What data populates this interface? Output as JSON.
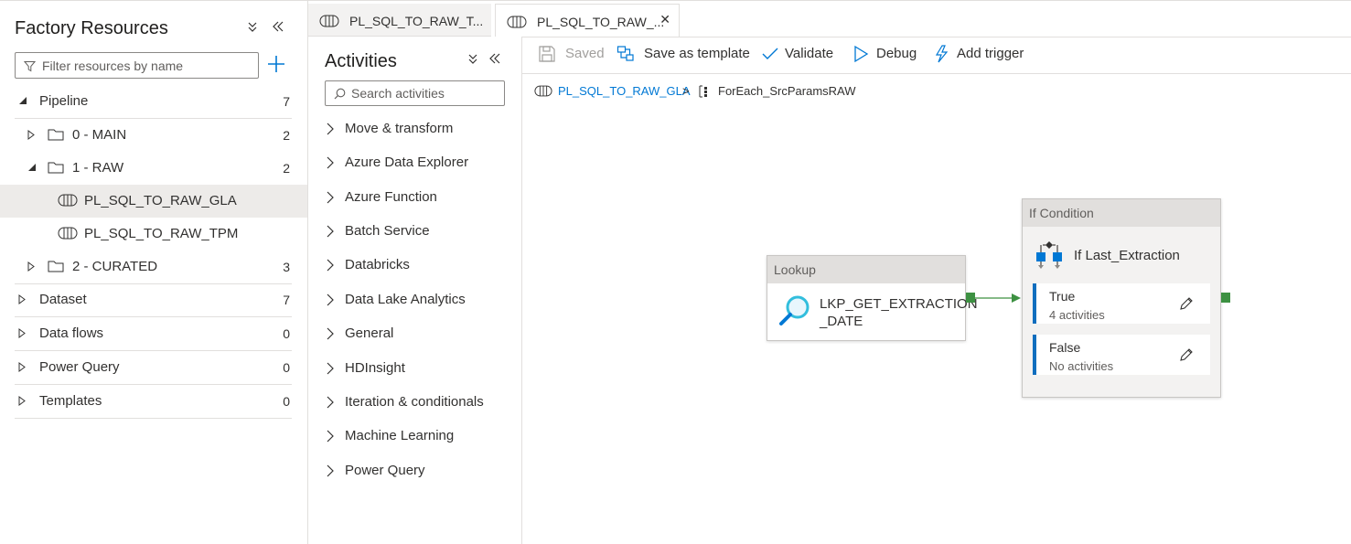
{
  "left_panel": {
    "title": "Factory Resources",
    "filter_placeholder": "Filter resources by name",
    "pipeline": {
      "label": "Pipeline",
      "count": "7"
    },
    "folders": [
      {
        "label": "0 - MAIN",
        "count": "2"
      },
      {
        "label": "1 - RAW",
        "count": "2"
      },
      {
        "label": "2 - CURATED",
        "count": "3"
      }
    ],
    "pipelines": [
      {
        "label": "PL_SQL_TO_RAW_GLA"
      },
      {
        "label": "PL_SQL_TO_RAW_TPM"
      }
    ],
    "sections": [
      {
        "label": "Dataset",
        "count": "7"
      },
      {
        "label": "Data flows",
        "count": "0"
      },
      {
        "label": "Power Query",
        "count": "0"
      },
      {
        "label": "Templates",
        "count": "0"
      }
    ]
  },
  "tabs": [
    {
      "label": "PL_SQL_TO_RAW_T..."
    },
    {
      "label": "PL_SQL_TO_RAW_..."
    }
  ],
  "activities": {
    "title": "Activities",
    "search_placeholder": "Search activities",
    "items": [
      "Move & transform",
      "Azure Data Explorer",
      "Azure Function",
      "Batch Service",
      "Databricks",
      "Data Lake Analytics",
      "General",
      "HDInsight",
      "Iteration & conditionals",
      "Machine Learning",
      "Power Query"
    ]
  },
  "toolbar": {
    "saved": "Saved",
    "save_template": "Save as template",
    "validate": "Validate",
    "debug": "Debug",
    "add_trigger": "Add trigger"
  },
  "breadcrumb": {
    "pipeline": "PL_SQL_TO_RAW_GLA",
    "separator": ">",
    "activity": "ForEach_SrcParamsRAW"
  },
  "canvas": {
    "lookup": {
      "header": "Lookup",
      "name_line1": "LKP_GET_EXTRACTION",
      "name_line2": "_DATE"
    },
    "if_condition": {
      "header": "If Condition",
      "name": "If Last_Extraction",
      "true_label": "True",
      "true_sub": "4 activities",
      "false_label": "False",
      "false_sub": "No activities"
    }
  },
  "colors": {
    "accent": "#0078d4",
    "success_connector": "#3d9142",
    "branch_bar": "#106ebe"
  }
}
